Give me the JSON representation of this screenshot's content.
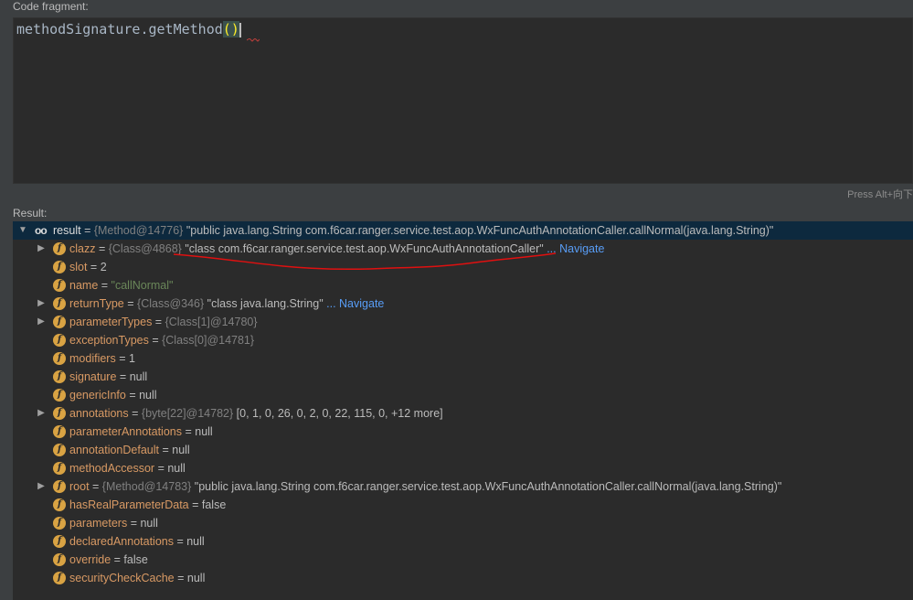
{
  "code_fragment_label": "Code fragment:",
  "code": {
    "prefix": "methodSignature.getMethod",
    "parens": "()"
  },
  "hint": "Press Alt+向下",
  "result_label": "Result:",
  "root": {
    "name": "result",
    "type": "{Method@14776}",
    "value": "\"public java.lang.String com.f6car.ranger.service.test.aop.WxFuncAuthAnnotationCaller.callNormal(java.lang.String)\""
  },
  "navigate": "... Navigate",
  "fields": [
    {
      "name": "clazz",
      "type": "{Class@4868}",
      "value": "\"class com.f6car.ranger.service.test.aop.WxFuncAuthAnnotationCaller\"",
      "nav": "... Navigate"
    },
    {
      "name": "slot",
      "value": "2"
    },
    {
      "name": "name",
      "str": "\"callNormal\""
    },
    {
      "name": "returnType",
      "type": "{Class@346}",
      "value": "\"class java.lang.String\"",
      "nav": "... Navigate"
    },
    {
      "name": "parameterTypes",
      "type": "{Class[1]@14780}"
    },
    {
      "name": "exceptionTypes",
      "type": "{Class[0]@14781}"
    },
    {
      "name": "modifiers",
      "value": "1"
    },
    {
      "name": "signature",
      "value": "null"
    },
    {
      "name": "genericInfo",
      "value": "null"
    },
    {
      "name": "annotations",
      "type": "{byte[22]@14782}",
      "value": "[0, 1, 0, 26, 0, 2, 0, 22, 115, 0, +12 more]"
    },
    {
      "name": "parameterAnnotations",
      "value": "null"
    },
    {
      "name": "annotationDefault",
      "value": "null"
    },
    {
      "name": "methodAccessor",
      "value": "null"
    },
    {
      "name": "root",
      "type": "{Method@14783}",
      "value": "\"public java.lang.String com.f6car.ranger.service.test.aop.WxFuncAuthAnnotationCaller.callNormal(java.lang.String)\""
    },
    {
      "name": "hasRealParameterData",
      "value": "false"
    },
    {
      "name": "parameters",
      "value": "null"
    },
    {
      "name": "declaredAnnotations",
      "value": "null"
    },
    {
      "name": "override",
      "value": "false"
    },
    {
      "name": "securityCheckCache",
      "value": "null"
    }
  ],
  "colors": {
    "background": "#3c3f41",
    "editor": "#2b2b2b",
    "selection": "#0d293e",
    "field_name": "#d99a64",
    "field_icon": "#d9a343",
    "link": "#589df6",
    "annotation_red": "#e01010"
  },
  "icons": {
    "root": "watch-oo-icon",
    "field": "field-f-icon",
    "expand": "chevron-right-icon",
    "collapse": "chevron-down-icon"
  }
}
